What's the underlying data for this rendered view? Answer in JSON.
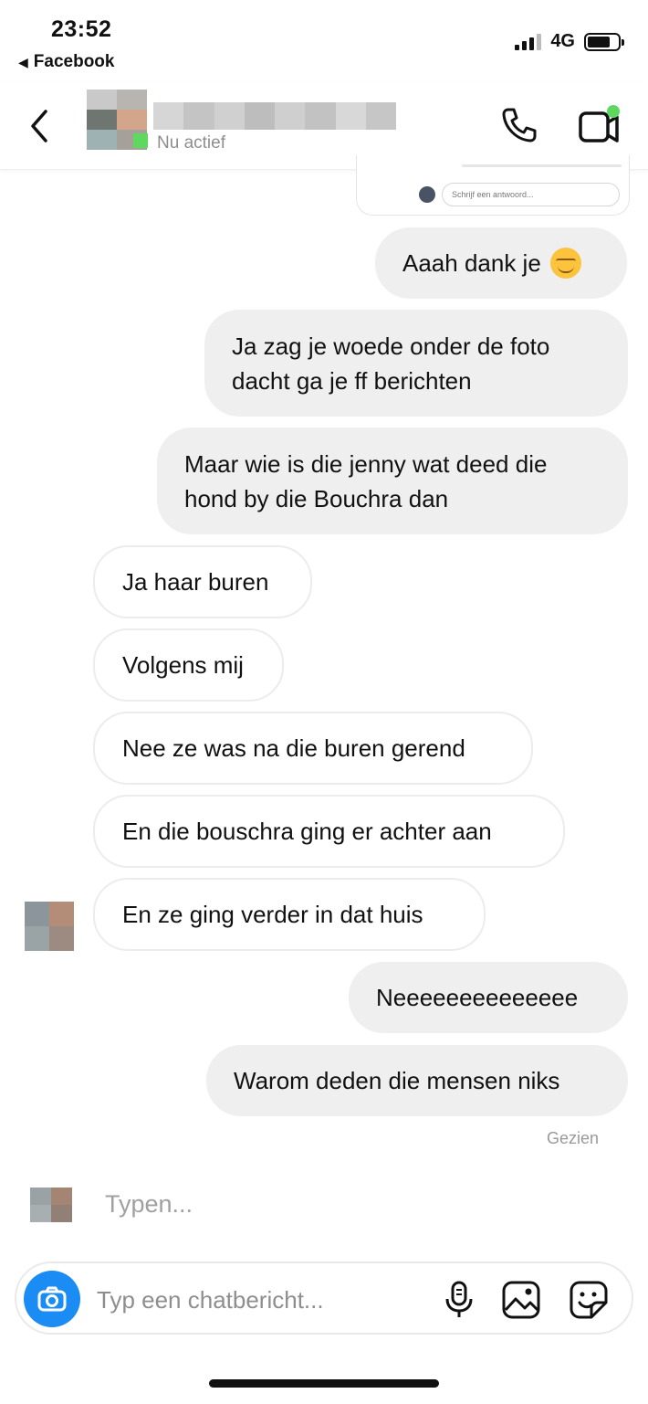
{
  "status_bar": {
    "time": "23:52",
    "back_app": "Facebook",
    "network": "4G",
    "battery_level": 0.75
  },
  "header": {
    "status": "Nu actief",
    "icons": [
      "back-arrow-icon",
      "phone-icon",
      "video-call-icon"
    ]
  },
  "preview_card": {
    "reply_placeholder": "Schrijf een antwoord..."
  },
  "messages": [
    {
      "direction": "sent",
      "text": "Aaah dank je",
      "emoji": "smiling-face-emoji"
    },
    {
      "direction": "sent",
      "lines": [
        "Ja zag je woede onder de foto",
        "dacht ga je ff berichten"
      ]
    },
    {
      "direction": "sent",
      "lines": [
        "Maar wie is die jenny wat deed die",
        "hond by die Bouchra dan"
      ]
    },
    {
      "direction": "received",
      "text": "Ja haar buren"
    },
    {
      "direction": "received",
      "text": "Volgens mij"
    },
    {
      "direction": "received",
      "text": "Nee ze was na die buren gerend"
    },
    {
      "direction": "received",
      "text": "En die bouschra ging er achter aan"
    },
    {
      "direction": "received",
      "text": "En ze ging verder in dat huis"
    },
    {
      "direction": "sent",
      "text": "Neeeeeeeeeeeeee"
    },
    {
      "direction": "sent",
      "text": "Warom deden die mensen niks"
    }
  ],
  "seen_label": "Gezien",
  "typing_label": "Typen...",
  "composer": {
    "placeholder": "Typ een chatbericht...",
    "value": "",
    "icons": [
      "camera-icon",
      "microphone-icon",
      "gallery-icon",
      "sticker-icon"
    ]
  },
  "colors": {
    "accent": "#1b8cf4",
    "online": "#5fd85f",
    "sent_bubble": "#efefef",
    "received_border": "#ececec"
  }
}
